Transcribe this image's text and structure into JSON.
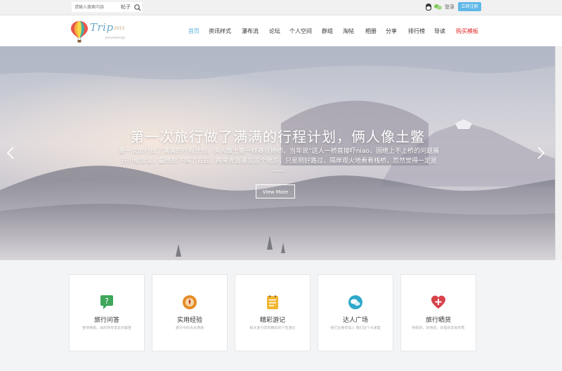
{
  "topbar": {
    "search_placeholder": "请输入搜索内容",
    "search_type": "帖子",
    "login": "登录",
    "signup": "立即注册"
  },
  "logo": {
    "text": "Trip",
    "year": "2015",
    "sub": "Joeviedesign"
  },
  "nav": {
    "items": [
      {
        "label": "首页"
      },
      {
        "label": "资讯样式"
      },
      {
        "label": "瀑布流"
      },
      {
        "label": "论坛"
      },
      {
        "label": "个人空间"
      },
      {
        "label": "群组"
      },
      {
        "label": "淘帖"
      },
      {
        "label": "相册"
      },
      {
        "label": "分享"
      },
      {
        "label": "排行榜"
      },
      {
        "label": "导读"
      },
      {
        "label": "购买模板"
      }
    ],
    "active": "首页"
  },
  "hero": {
    "title": "第一次旅行做了满满的行程计划，俩人像土鳖",
    "desc": "第一次旅行做了满满的行程计划，俩人像土鳖一样赛往她桥，当年说“这人一桥直接吓niao，固绝上不上桥的问题展开小组会议，最终败下阵了去去，再来青岛遇见这个地方，只是刚好路过，隔岸观火地看看栈桥，忽然觉得一定是——",
    "button": "View More"
  },
  "cards": [
    {
      "icon": "qa-icon",
      "title": "旅行问答",
      "desc": "答特难题，目的地专享去天解答"
    },
    {
      "icon": "experience-icon",
      "title": "实用经验",
      "desc": "旅行中的点点滴滴"
    },
    {
      "icon": "travelogue-icon",
      "title": "精彩游记",
      "desc": "和大家分享你精彩的个性游记"
    },
    {
      "icon": "plaza-icon",
      "title": "达人广场",
      "desc": "我们在等你加入 我们这个大家庭"
    },
    {
      "icon": "showcase-icon",
      "title": "旅行晒货",
      "desc": "特别的，好用的，好看的去有你秀"
    }
  ],
  "colors": {
    "accent": "#5aaee0",
    "buy": "#e02a2a",
    "signup_bg": "#5fb8e8"
  }
}
